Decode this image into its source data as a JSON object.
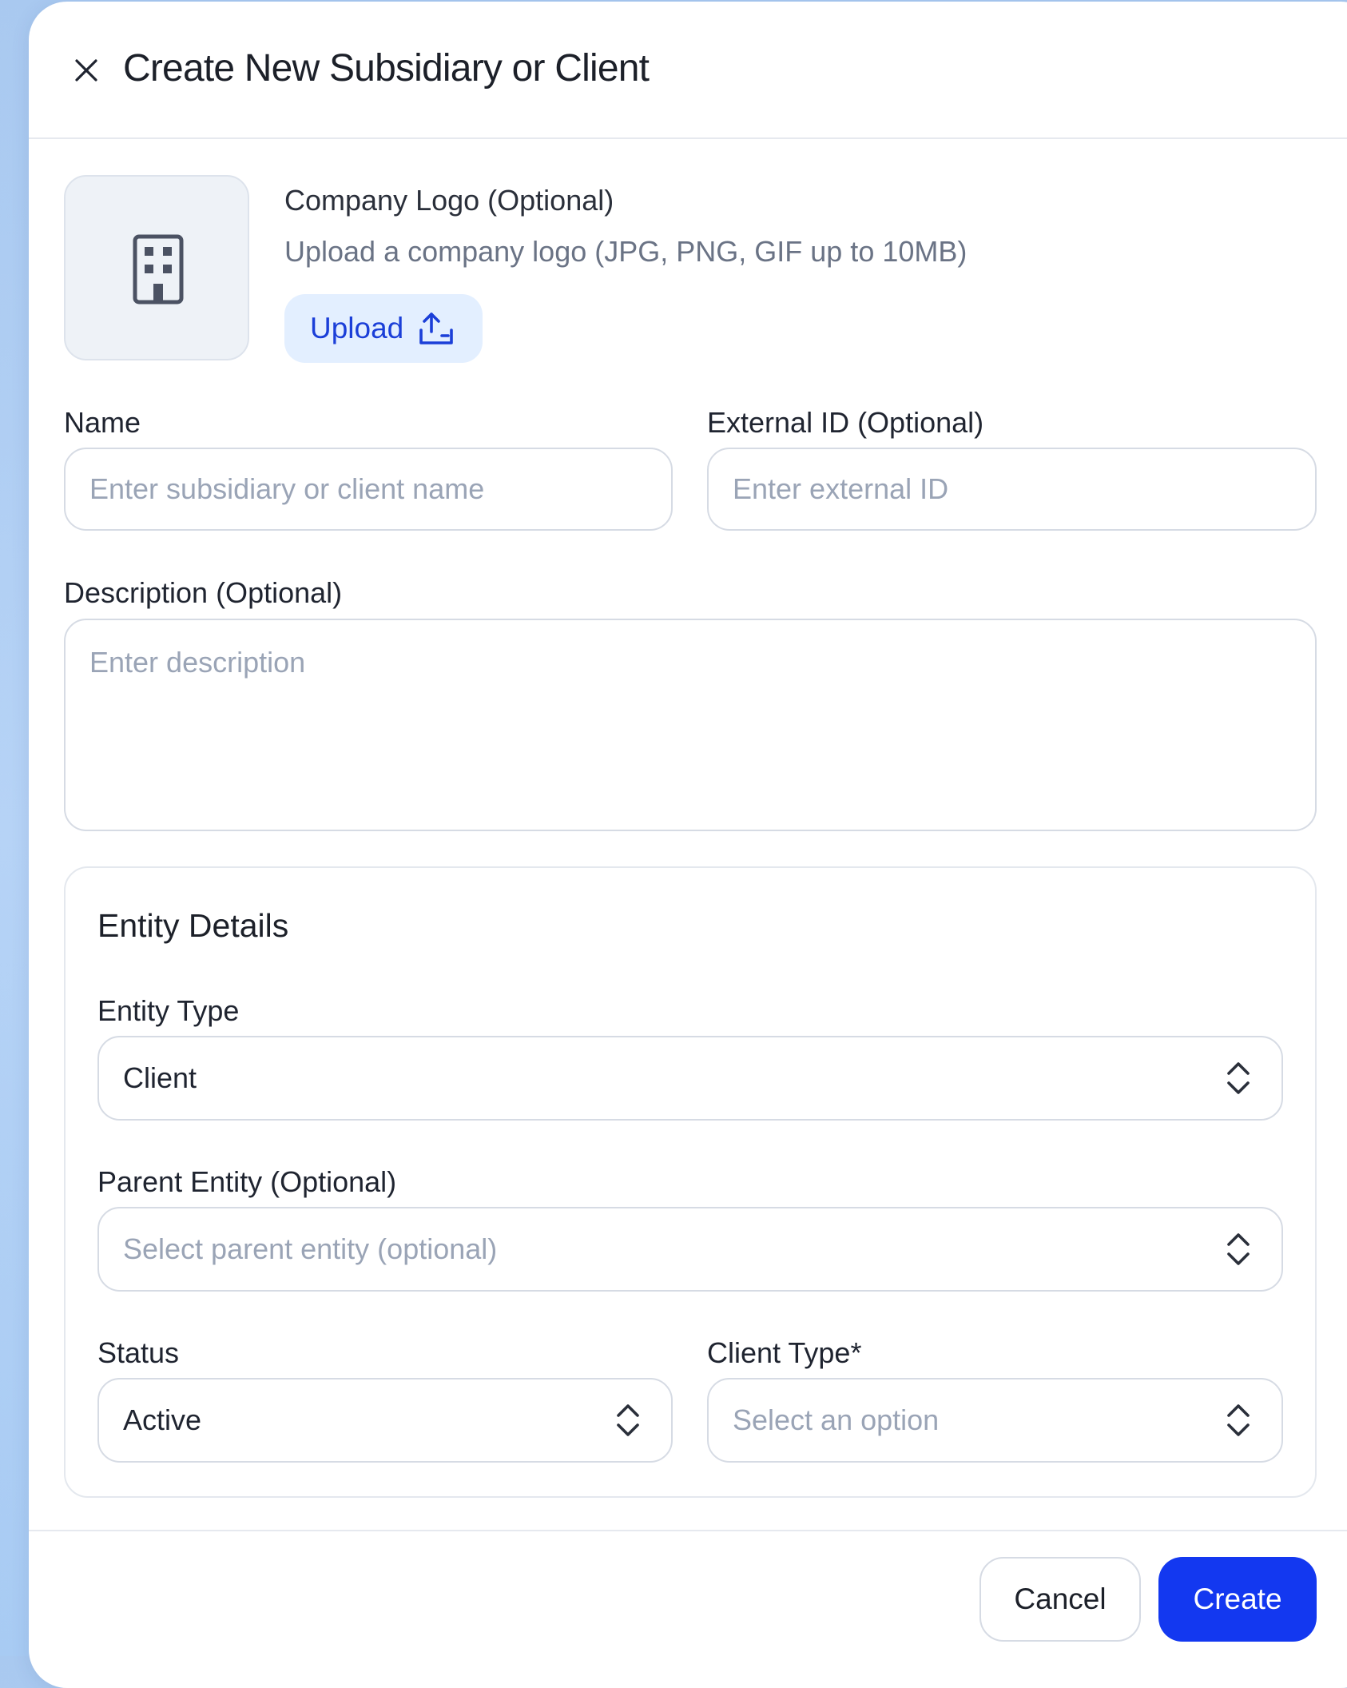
{
  "dialog": {
    "title": "Create New Subsidiary or Client",
    "close_icon": "close-icon"
  },
  "logo": {
    "icon": "building-icon",
    "title": "Company Logo (Optional)",
    "subtitle": "Upload a company logo (JPG, PNG, GIF up to 10MB)",
    "upload_label": "Upload",
    "upload_icon": "upload-icon"
  },
  "form": {
    "name": {
      "label": "Name",
      "placeholder": "Enter subsidiary or client name",
      "value": ""
    },
    "external_id": {
      "label": "External ID (Optional)",
      "placeholder": "Enter external ID",
      "value": ""
    },
    "description": {
      "label": "Description (Optional)",
      "placeholder": "Enter description",
      "value": ""
    }
  },
  "entity_details": {
    "title": "Entity Details",
    "entity_type": {
      "label": "Entity Type",
      "value": "Client"
    },
    "parent_entity": {
      "label": "Parent Entity (Optional)",
      "placeholder": "Select parent entity (optional)"
    },
    "status": {
      "label": "Status",
      "value": "Active"
    },
    "client_type": {
      "label": "Client Type*",
      "placeholder": "Select an option"
    }
  },
  "footer": {
    "cancel_label": "Cancel",
    "create_label": "Create"
  },
  "colors": {
    "primary": "#1338f0",
    "upload_bg": "#e3efff",
    "upload_text": "#1b3fd8",
    "placeholder": "#9aa4b6",
    "border": "#d6dbe4"
  }
}
